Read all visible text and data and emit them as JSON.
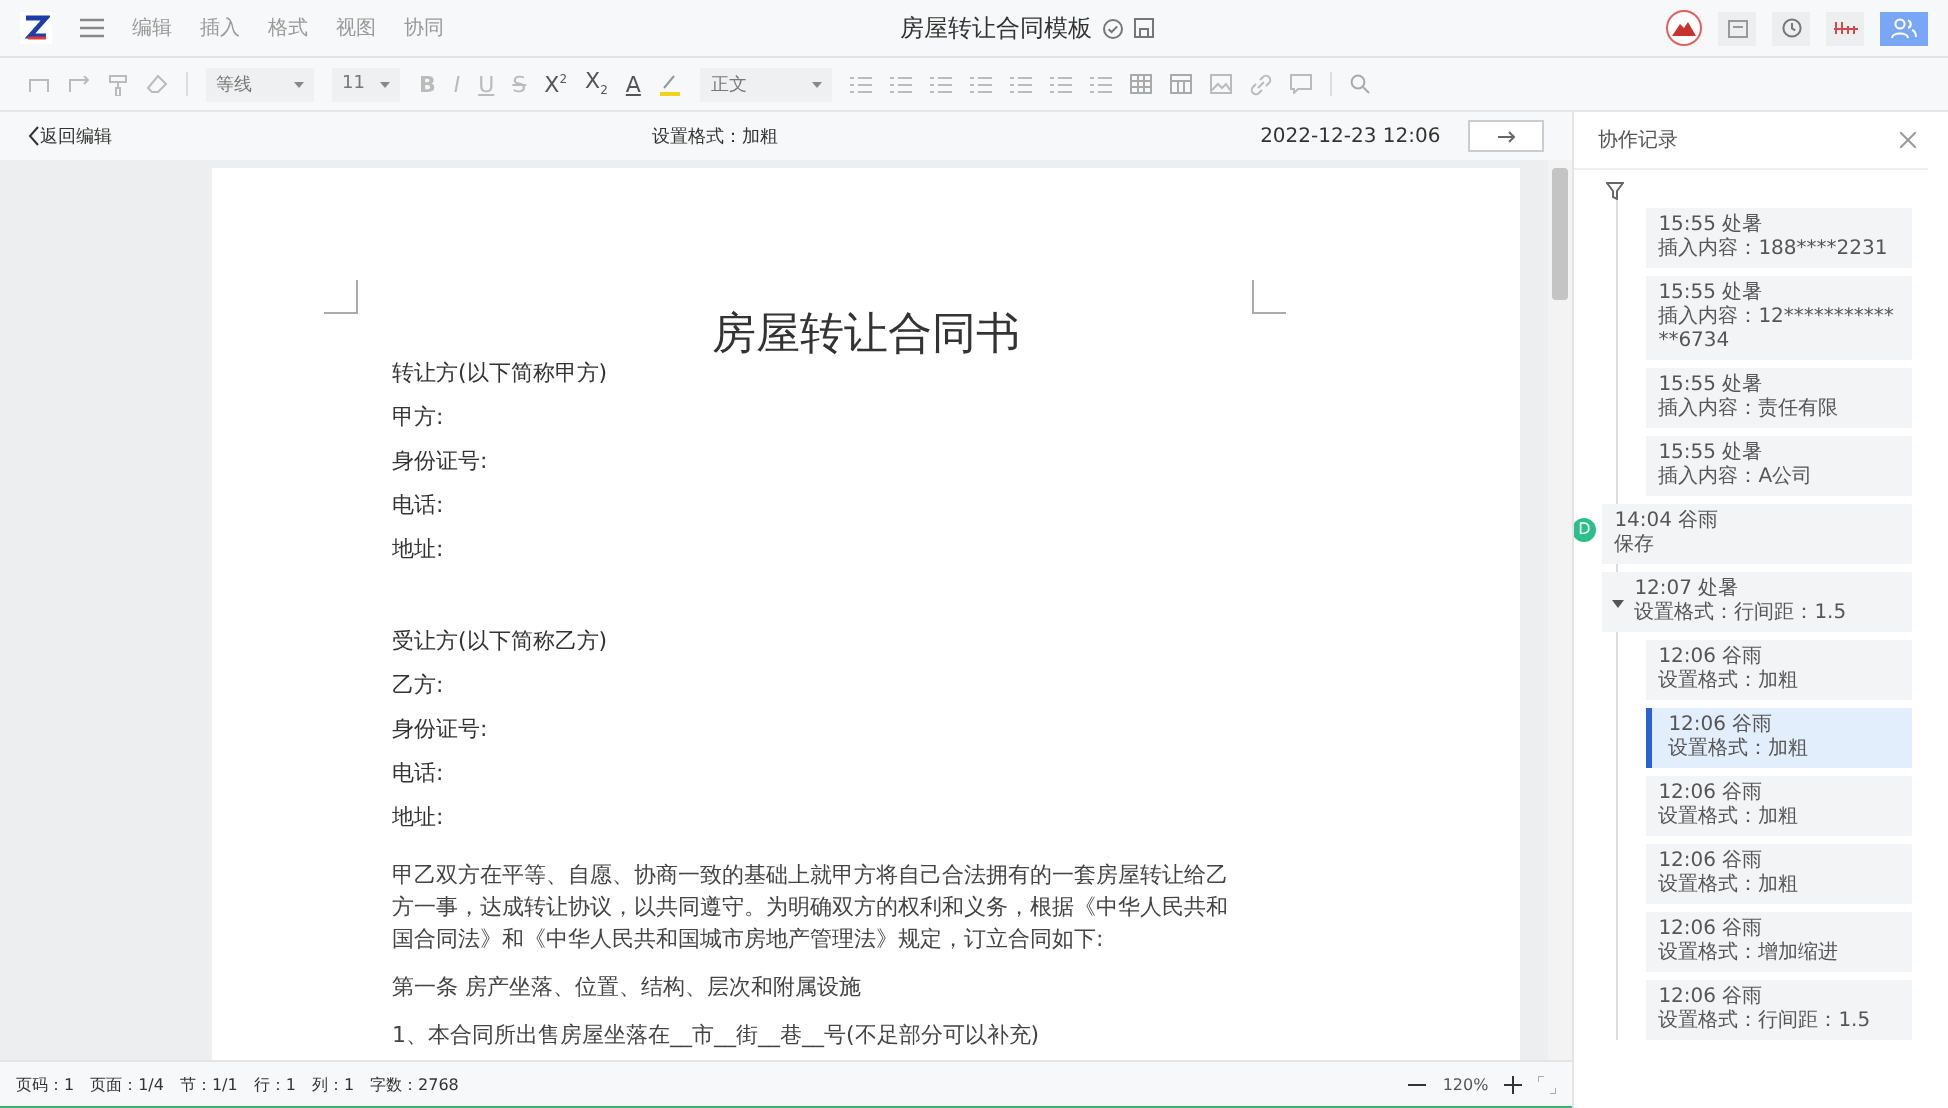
{
  "menu": {
    "items": [
      "编辑",
      "插入",
      "格式",
      "视图",
      "协同"
    ]
  },
  "document_title": "房屋转让合同模板",
  "toolbar": {
    "font": "等线",
    "size": "11",
    "style": "正文",
    "format_buttons": [
      {
        "kind": "bold",
        "label": "B"
      },
      {
        "kind": "italic",
        "label": "I"
      },
      {
        "kind": "underline",
        "label": "U"
      },
      {
        "kind": "strike",
        "label": "S"
      },
      {
        "kind": "sup",
        "label": "X",
        "mark": "2"
      },
      {
        "kind": "sub",
        "label": "X",
        "mark": "2"
      },
      {
        "kind": "color",
        "label": "A"
      }
    ]
  },
  "history_bar": {
    "back": "返回编辑",
    "action": "设置格式：加粗",
    "timestamp": "2022-12-23 12:06"
  },
  "page": {
    "title": "房屋转让合同书",
    "blocks": [
      {
        "kind": "lines",
        "lines": [
          "转让方(以下简称甲方)",
          "甲方:",
          "身份证号:",
          "电话:",
          "地址:"
        ]
      },
      {
        "kind": "lines",
        "lines": [
          "受让方(以下简称乙方)",
          "乙方:",
          "身份证号:",
          "电话:",
          "地址:"
        ]
      },
      {
        "kind": "paragraph",
        "text": "甲乙双方在平等、自愿、协商一致的基础上就甲方将自己合法拥有的一套房屋转让给乙方一事，达成转让协议，以共同遵守。为明确双方的权利和义务，根据《中华人民共和国合同法》和《中华人民共和国城市房地产管理法》规定，订立合同如下:"
      },
      {
        "kind": "paragraph",
        "text": "第一条  房产坐落、位置、结构、层次和附属设施"
      },
      {
        "kind": "paragraph",
        "text": "1、本合同所出售房屋坐落在__市__街__巷__号(不足部分可以补充)"
      }
    ]
  },
  "status_bar": {
    "items": [
      "页码：1",
      "页面：1/4",
      "节：1/1",
      "行：1",
      "列：1",
      "字数：2768"
    ],
    "zoom": "120%"
  },
  "panel": {
    "title": "协作记录",
    "timeline": [
      {
        "kind": "group",
        "children": [
          {
            "time": "15:55",
            "author": "处暑",
            "action": "插入内容：188****2231",
            "selected": false
          },
          {
            "time": "15:55",
            "author": "处暑",
            "action": "插入内容：12*************6734",
            "selected": false
          },
          {
            "time": "15:55",
            "author": "处暑",
            "action": "插入内容：责任有限",
            "selected": false
          },
          {
            "time": "15:55",
            "author": "处暑",
            "action": "插入内容：A公司",
            "selected": false
          }
        ]
      },
      {
        "kind": "entry",
        "marker": "D",
        "time": "14:04",
        "author": "谷雨",
        "action": "保存"
      },
      {
        "kind": "group",
        "expanded": true,
        "time": "12:07",
        "author": "处暑",
        "action": "设置格式：行间距：1.5",
        "children": [
          {
            "time": "12:06",
            "author": "谷雨",
            "action": "设置格式：加粗",
            "selected": false
          },
          {
            "time": "12:06",
            "author": "谷雨",
            "action": "设置格式：加粗",
            "selected": true
          },
          {
            "time": "12:06",
            "author": "谷雨",
            "action": "设置格式：加粗",
            "selected": false
          },
          {
            "time": "12:06",
            "author": "谷雨",
            "action": "设置格式：加粗",
            "selected": false
          },
          {
            "time": "12:06",
            "author": "谷雨",
            "action": "设置格式：增加缩进",
            "selected": false
          },
          {
            "time": "12:06",
            "author": "谷雨",
            "action": "设置格式：行间距：1.5",
            "selected": false
          }
        ]
      }
    ]
  }
}
